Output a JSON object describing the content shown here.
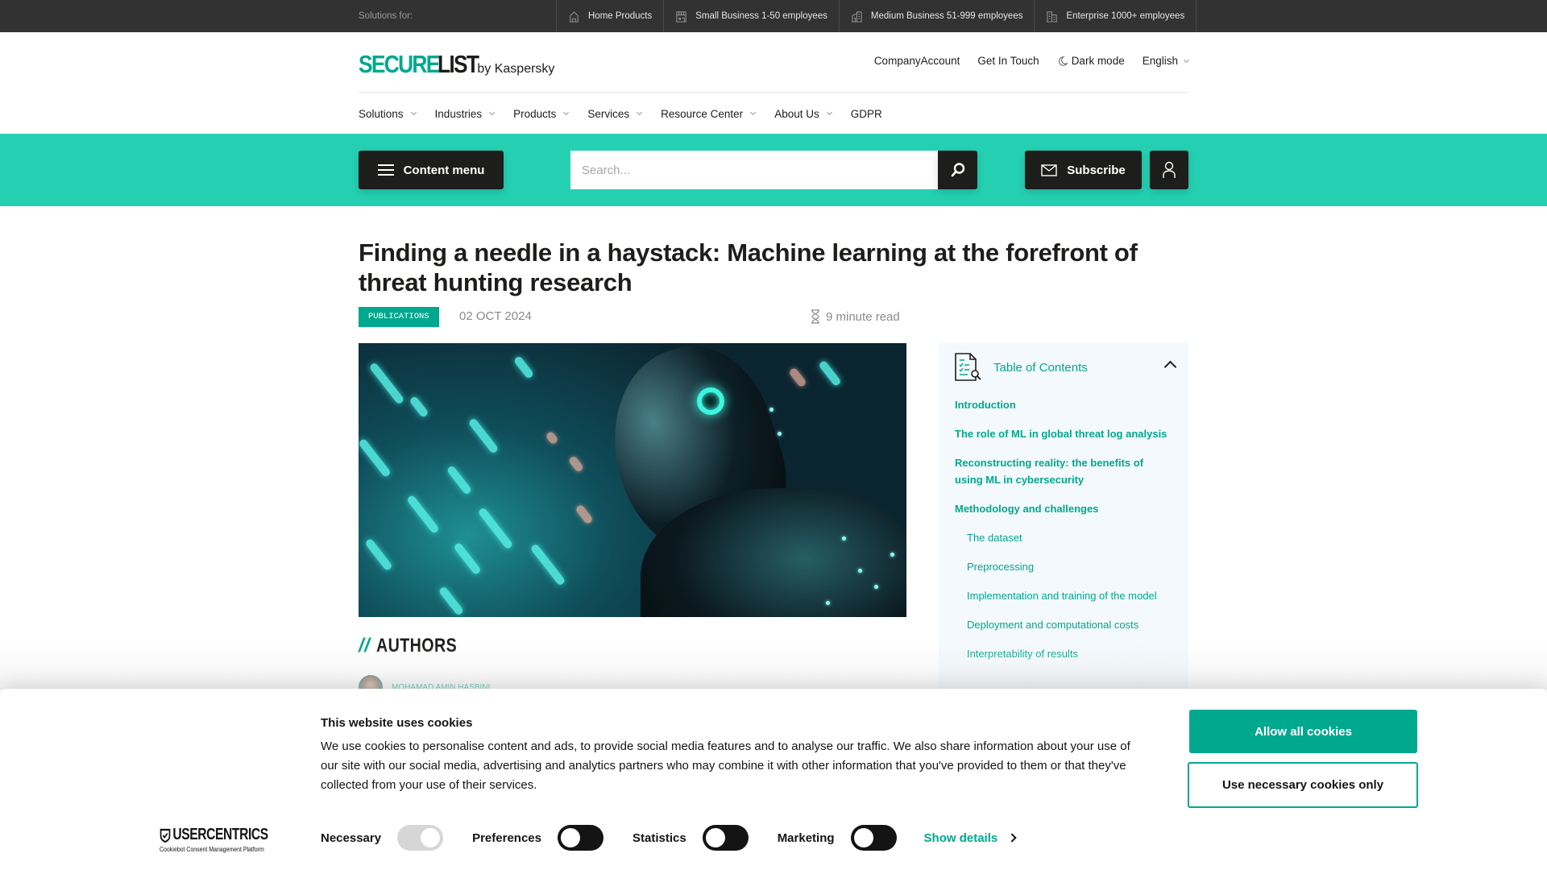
{
  "topbar": {
    "label": "Solutions for:",
    "items": [
      {
        "icon": "home-icon",
        "label": "Home Products"
      },
      {
        "icon": "small-business-icon",
        "label": "Small Business 1-50 employees"
      },
      {
        "icon": "medium-business-icon",
        "label": "Medium Business 51-999 employees"
      },
      {
        "icon": "enterprise-icon",
        "label": "Enterprise 1000+ employees"
      }
    ]
  },
  "header": {
    "logo_secure": "SECURE",
    "logo_list": "LIST",
    "logo_by": "by Kaspersky",
    "company_account": "CompanyAccount",
    "get_in_touch": "Get In Touch",
    "dark_mode": "Dark mode",
    "language": "English"
  },
  "nav": {
    "items": [
      {
        "label": "Solutions",
        "dropdown": true
      },
      {
        "label": "Industries",
        "dropdown": true
      },
      {
        "label": "Products",
        "dropdown": true
      },
      {
        "label": "Services",
        "dropdown": true
      },
      {
        "label": "Resource Center",
        "dropdown": true
      },
      {
        "label": "About Us",
        "dropdown": true
      },
      {
        "label": "GDPR",
        "dropdown": false
      }
    ]
  },
  "toolbar": {
    "content_menu": "Content menu",
    "search_placeholder": "Search...",
    "subscribe": "Subscribe"
  },
  "article": {
    "title": "Finding a needle in a haystack: Machine learning at the forefront of threat hunting research",
    "category": "PUBLICATIONS",
    "date": "02 OCT 2024",
    "read_time": "9 minute read",
    "authors_heading": "AUTHORS",
    "authors_slashes": "//",
    "authors": [
      {
        "name": "MOHAMAD AMIN HASBINI"
      }
    ]
  },
  "toc": {
    "title": "Table of Contents",
    "items": [
      {
        "label": "Introduction",
        "level": 1
      },
      {
        "label": "The role of ML in global threat log analysis",
        "level": 1
      },
      {
        "label": "Reconstructing reality: the benefits of using ML in cybersecurity",
        "level": 1
      },
      {
        "label": "Methodology and challenges",
        "level": 1
      },
      {
        "label": "The dataset",
        "level": 2
      },
      {
        "label": "Preprocessing",
        "level": 2
      },
      {
        "label": "Implementation and training of the model",
        "level": 2
      },
      {
        "label": "Deployment and computational costs",
        "level": 2
      },
      {
        "label": "Interpretability of results",
        "level": 2
      }
    ]
  },
  "cookie": {
    "title": "This website uses cookies",
    "body": "We use cookies to personalise content and ads, to provide social media features and to analyse our traffic. We also share information about your use of our site with our social media, advertising and analytics partners who may combine it with other information that you've provided to them or that they've collected from your use of their services.",
    "brand": "USERCENTRICS",
    "brand_sub": "Cookiebot Consent Management Platform",
    "toggles": [
      {
        "label": "Necessary",
        "state": "on-disabled"
      },
      {
        "label": "Preferences",
        "state": "off"
      },
      {
        "label": "Statistics",
        "state": "off"
      },
      {
        "label": "Marketing",
        "state": "off"
      }
    ],
    "show_details": "Show details",
    "allow_all": "Allow all cookies",
    "necessary_only": "Use necessary cookies only"
  },
  "colors": {
    "brand_green": "#00a88e",
    "band_green": "#25d0b2",
    "topbar_bg": "#323232",
    "dark_button": "#1d1d1b"
  }
}
